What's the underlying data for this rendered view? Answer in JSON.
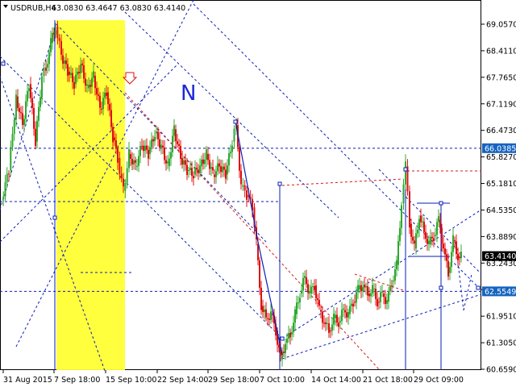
{
  "title": "USDRUB,H4",
  "ohlc_header": "63.0830 63.4647 63.0830 63.4140",
  "wave_label": "N",
  "colors": {
    "bull": "#2fa82f",
    "bear": "#e01010",
    "grid": "#0a1fb5",
    "projection_red": "#d81818",
    "highlight": "#ffff33",
    "current_price_tag": "#000000",
    "level_tag": "#1565c0"
  },
  "chart_data": {
    "type": "candlestick",
    "symbol": "USDRUB",
    "timeframe": "H4",
    "y_ticks": [
      "69.0570",
      "68.4110",
      "67.7650",
      "67.1190",
      "66.4730",
      "65.8270",
      "65.1810",
      "64.5350",
      "63.8890",
      "63.2430",
      "62.5970",
      "61.9510",
      "61.3050",
      "60.6590"
    ],
    "x_ticks": [
      "31 Aug 2015",
      "7 Sep 18:00",
      "15 Sep 10:00",
      "22 Sep 14:00",
      "29 Sep 18:00",
      "7 Oct 10:00",
      "14 Oct 14:00",
      "21 Oct 18:00",
      "29 Oct 09:00"
    ],
    "ylim": [
      60.5,
      69.5
    ],
    "current_price": "63.4140",
    "levels": [
      {
        "label": "66.0385",
        "value": 66.0385
      },
      {
        "label": "62.5549",
        "value": 62.5549
      }
    ],
    "points": [
      {
        "t": 2,
        "y": 64.8
      },
      {
        "t": 11,
        "y": 65.5
      },
      {
        "t": 20,
        "y": 67.3
      },
      {
        "t": 28,
        "y": 66.6
      },
      {
        "t": 36,
        "y": 67.6
      },
      {
        "t": 44,
        "y": 66.2
      },
      {
        "t": 52,
        "y": 67.8
      },
      {
        "t": 57,
        "y": 68.0
      },
      {
        "t": 63,
        "y": 68.6
      },
      {
        "t": 69,
        "y": 69.0
      },
      {
        "t": 76,
        "y": 68.3
      },
      {
        "t": 84,
        "y": 67.9
      },
      {
        "t": 92,
        "y": 67.6
      },
      {
        "t": 100,
        "y": 68.1
      },
      {
        "t": 108,
        "y": 67.5
      },
      {
        "t": 116,
        "y": 67.8
      },
      {
        "t": 124,
        "y": 67.0
      },
      {
        "t": 132,
        "y": 67.4
      },
      {
        "t": 140,
        "y": 66.3
      },
      {
        "t": 146,
        "y": 65.8
      },
      {
        "t": 153,
        "y": 65.0
      },
      {
        "t": 160,
        "y": 65.9
      },
      {
        "t": 168,
        "y": 65.6
      },
      {
        "t": 176,
        "y": 66.1
      },
      {
        "t": 184,
        "y": 65.9
      },
      {
        "t": 192,
        "y": 66.4
      },
      {
        "t": 200,
        "y": 66.1
      },
      {
        "t": 208,
        "y": 65.6
      },
      {
        "t": 216,
        "y": 66.5
      },
      {
        "t": 224,
        "y": 65.8
      },
      {
        "t": 232,
        "y": 65.5
      },
      {
        "t": 240,
        "y": 65.4
      },
      {
        "t": 248,
        "y": 65.6
      },
      {
        "t": 256,
        "y": 65.9
      },
      {
        "t": 264,
        "y": 65.4
      },
      {
        "t": 272,
        "y": 65.6
      },
      {
        "t": 280,
        "y": 65.4
      },
      {
        "t": 288,
        "y": 66.2
      },
      {
        "t": 293,
        "y": 66.6
      },
      {
        "t": 299,
        "y": 65.1
      },
      {
        "t": 306,
        "y": 64.9
      },
      {
        "t": 313,
        "y": 64.6
      },
      {
        "t": 318,
        "y": 63.7
      },
      {
        "t": 324,
        "y": 62.2
      },
      {
        "t": 330,
        "y": 61.9
      },
      {
        "t": 336,
        "y": 62.0
      },
      {
        "t": 342,
        "y": 61.6
      },
      {
        "t": 348,
        "y": 60.9
      },
      {
        "t": 354,
        "y": 61.3
      },
      {
        "t": 360,
        "y": 61.5
      },
      {
        "t": 366,
        "y": 62.0
      },
      {
        "t": 372,
        "y": 62.5
      },
      {
        "t": 378,
        "y": 62.9
      },
      {
        "t": 384,
        "y": 62.5
      },
      {
        "t": 390,
        "y": 62.7
      },
      {
        "t": 396,
        "y": 62.1
      },
      {
        "t": 402,
        "y": 61.8
      },
      {
        "t": 408,
        "y": 61.6
      },
      {
        "t": 414,
        "y": 61.9
      },
      {
        "t": 420,
        "y": 61.8
      },
      {
        "t": 426,
        "y": 62.1
      },
      {
        "t": 432,
        "y": 62.0
      },
      {
        "t": 438,
        "y": 62.3
      },
      {
        "t": 444,
        "y": 62.6
      },
      {
        "t": 450,
        "y": 62.7
      },
      {
        "t": 456,
        "y": 62.5
      },
      {
        "t": 462,
        "y": 62.6
      },
      {
        "t": 468,
        "y": 62.3
      },
      {
        "t": 474,
        "y": 62.5
      },
      {
        "t": 480,
        "y": 62.3
      },
      {
        "t": 486,
        "y": 62.8
      },
      {
        "t": 492,
        "y": 63.2
      },
      {
        "t": 498,
        "y": 64.7
      },
      {
        "t": 503,
        "y": 65.6
      },
      {
        "t": 508,
        "y": 64.2
      },
      {
        "t": 514,
        "y": 63.6
      },
      {
        "t": 520,
        "y": 64.4
      },
      {
        "t": 526,
        "y": 64.0
      },
      {
        "t": 532,
        "y": 63.7
      },
      {
        "t": 538,
        "y": 63.9
      },
      {
        "t": 544,
        "y": 64.3
      },
      {
        "t": 550,
        "y": 63.6
      },
      {
        "t": 556,
        "y": 63.0
      },
      {
        "t": 562,
        "y": 63.8
      },
      {
        "t": 568,
        "y": 63.4
      },
      {
        "t": 572,
        "y": 63.4
      }
    ]
  }
}
